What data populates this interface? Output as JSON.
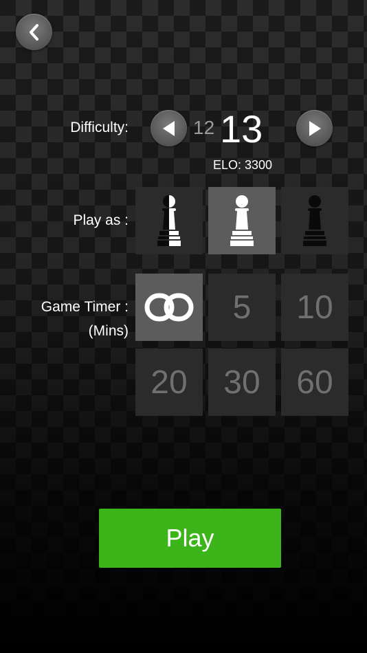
{
  "icons": {
    "back": "chevron-left-icon",
    "prev": "triangle-left-icon",
    "next": "triangle-right-icon",
    "infinity": "infinity-icon",
    "pawn": "pawn-icon"
  },
  "difficulty": {
    "label": "Difficulty:",
    "previous_level": "12",
    "current_level": "13",
    "elo": "ELO: 3300"
  },
  "play_as": {
    "label": "Play as :",
    "options": [
      "random",
      "white",
      "black"
    ],
    "selected": "white"
  },
  "game_timer": {
    "label_line1": "Game Timer :",
    "label_line2": "(Mins)",
    "options": [
      "∞",
      "5",
      "10",
      "20",
      "30",
      "60"
    ],
    "selected": "∞"
  },
  "play_button": {
    "label": "Play"
  },
  "colors": {
    "play_button": "#3cb51a",
    "tile": "#2b2b2b",
    "tile_selected": "#5c5c5c"
  }
}
